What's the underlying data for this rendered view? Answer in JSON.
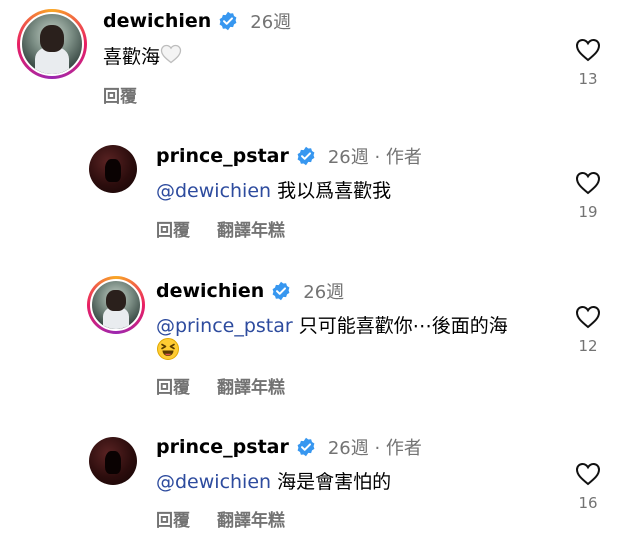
{
  "comments": [
    {
      "username": "dewichien",
      "time": "26週",
      "text": "喜歡海",
      "reply_label": "回覆",
      "likes": "13"
    },
    {
      "username": "prince_pstar",
      "time": "26週 · 作者",
      "mention": "@dewichien",
      "text": " 我以爲喜歡我",
      "reply_label": "回覆",
      "translate_label": "翻譯年糕",
      "likes": "19"
    },
    {
      "username": "dewichien",
      "time": "26週",
      "mention": "@prince_pstar",
      "text": " 只可能喜歡你⋯後面的海",
      "reply_label": "回覆",
      "translate_label": "翻譯年糕",
      "likes": "12"
    },
    {
      "username": "prince_pstar",
      "time": "26週 · 作者",
      "mention": "@dewichien",
      "text": " 海是會害怕的",
      "reply_label": "回覆",
      "translate_label": "翻譯年糕",
      "likes": "16"
    }
  ],
  "colors": {
    "verified": "#3797f0",
    "mention": "#2d4b9e",
    "muted": "#737373"
  },
  "icons": {
    "verified": "verified-badge-icon",
    "like": "heart-outline-icon",
    "white_heart": "white-heart-emoji",
    "laughing": "laughing-face-emoji"
  }
}
